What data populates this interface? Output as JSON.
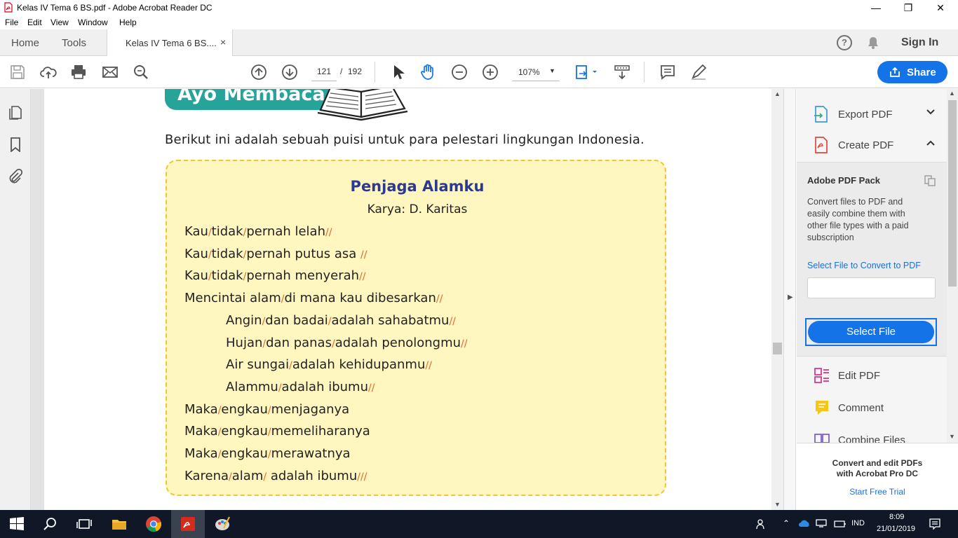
{
  "window": {
    "title": "Kelas IV Tema 6 BS.pdf - Adobe Acrobat Reader DC",
    "minimize": "—",
    "maximize": "❐",
    "close": "✕"
  },
  "menu": [
    "File",
    "Edit",
    "View",
    "Window",
    "Help"
  ],
  "tabs": {
    "home": "Home",
    "tools": "Tools",
    "document": "Kelas IV Tema 6 BS....",
    "close": "×",
    "help": "?",
    "sign_in": "Sign In"
  },
  "toolbar": {
    "current_page": "121",
    "page_sep": "/",
    "total_pages": "192",
    "zoom": "107%",
    "share": "Share"
  },
  "document": {
    "heading": "Ayo Membaca",
    "intro": "Berikut ini adalah sebuah puisi untuk para pelestari lingkungan Indonesia.",
    "poem_title": "Penjaga Alamku",
    "poem_author": "Karya: D. Karitas",
    "lines": [
      {
        "parts": [
          "Kau",
          "/",
          "tidak",
          "/",
          "pernah lelah",
          "//"
        ]
      },
      {
        "parts": [
          "Kau",
          "/",
          "tidak",
          "/",
          "pernah putus asa ",
          "//"
        ]
      },
      {
        "parts": [
          "Kau",
          "/",
          "tidak",
          "/",
          "pernah menyerah",
          "//"
        ]
      },
      {
        "parts": [
          "Mencintai alam",
          "/",
          "di mana kau dibesarkan",
          "//"
        ]
      },
      {
        "parts": [
          "Angin",
          "/",
          "dan badai",
          "/",
          "adalah sahabatmu",
          "//"
        ]
      },
      {
        "parts": [
          "Hujan",
          "/",
          "dan panas",
          "/",
          "adalah penolongmu",
          "//"
        ]
      },
      {
        "parts": [
          "Air sungai",
          "/",
          "adalah kehidupanmu",
          "//"
        ]
      },
      {
        "parts": [
          "Alammu",
          "/",
          "adalah ibumu",
          "//"
        ]
      },
      {
        "parts": [
          "Maka",
          "/",
          "engkau",
          "/",
          "menjaganya",
          ""
        ]
      },
      {
        "parts": [
          "Maka",
          "/",
          "engkau",
          "/",
          "memeliharanya",
          ""
        ]
      },
      {
        "parts": [
          "Maka",
          "/",
          "engkau",
          "/",
          "merawatnya",
          ""
        ]
      },
      {
        "parts": [
          "Karena",
          "/",
          "alam",
          "/",
          " adalah ibumu",
          "///"
        ]
      }
    ]
  },
  "right_panel": {
    "export_pdf": "Export PDF",
    "create_pdf": "Create PDF",
    "chev_down": "⌄",
    "chev_up": "⌃",
    "pack_title": "Adobe PDF Pack",
    "pack_desc": "Convert files to PDF and easily combine them with other file types with a paid subscription",
    "select_link": "Select File to Convert to PDF",
    "select_button": "Select File",
    "edit_pdf": "Edit PDF",
    "comment": "Comment",
    "combine_files": "Combine Files",
    "promo": "Convert and edit PDFs with Acrobat Pro DC",
    "trial": "Start Free Trial"
  },
  "taskbar": {
    "lang": "IND",
    "time": "8:09",
    "date": "21/01/2019"
  },
  "colors": {
    "accent": "#1473e6",
    "banner": "#26a49a",
    "poem_bg": "#fff7bf",
    "poem_border": "#f2c533",
    "title": "#2b3a8f",
    "pause": "#e8672b"
  }
}
